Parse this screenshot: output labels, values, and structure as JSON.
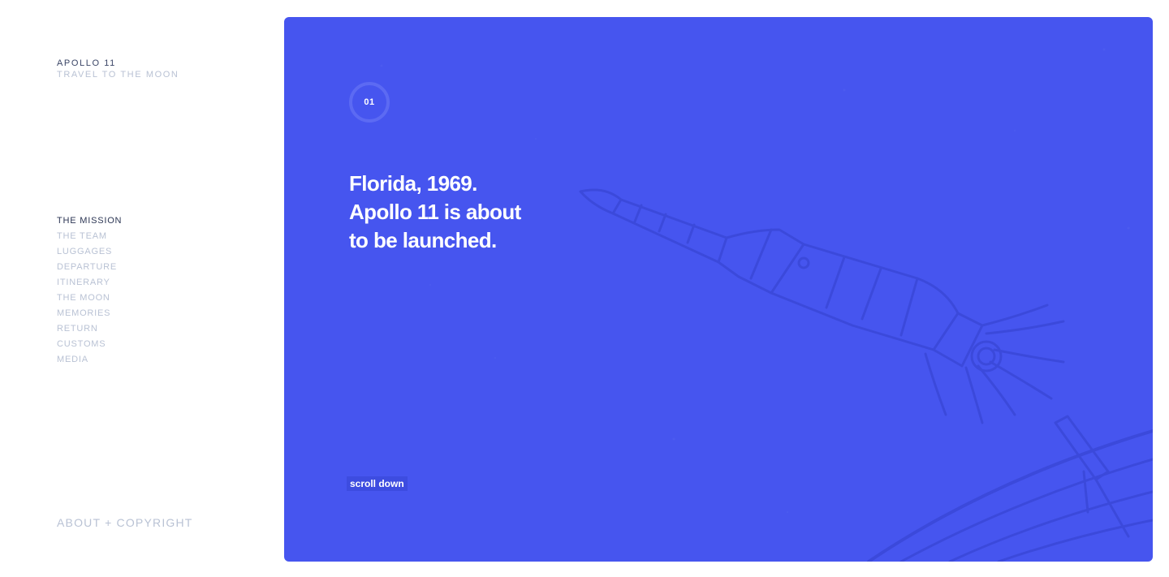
{
  "brand": {
    "title": "APOLLO 11",
    "subtitle": "TRAVEL TO THE MOON"
  },
  "nav": {
    "items": [
      {
        "label": "THE MISSION",
        "active": true
      },
      {
        "label": "THE TEAM"
      },
      {
        "label": "LUGGAGES"
      },
      {
        "label": "DEPARTURE"
      },
      {
        "label": "ITINERARY"
      },
      {
        "label": "THE MOON"
      },
      {
        "label": "MEMORIES"
      },
      {
        "label": "RETURN"
      },
      {
        "label": "CUSTOMS"
      },
      {
        "label": "MEDIA"
      }
    ]
  },
  "footer": {
    "about_label": "ABOUT + COPYRIGHT"
  },
  "hero": {
    "step_number": "01",
    "headline_lines": [
      "Florida, 1969.",
      "Apollo 11 is about",
      "to be launched."
    ],
    "scroll_label": "scroll down",
    "illustration_icon": "rocket-sketch-icon"
  },
  "colors": {
    "hero_background": "#4655ef",
    "sketch_lines": "#3a48d8",
    "nav_active": "#2c3654",
    "nav_inactive": "#b9c2d4"
  }
}
